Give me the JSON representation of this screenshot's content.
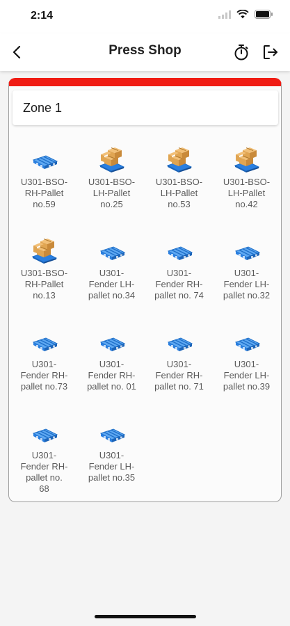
{
  "status_bar": {
    "time": "2:14"
  },
  "app_bar": {
    "title": "Press Shop"
  },
  "zone": {
    "title": "Zone 1",
    "pallets": [
      {
        "label": "U301-BSO-\nRH-Pallet\nno.59",
        "icon": "empty-pallet-icon"
      },
      {
        "label": "U301-BSO-\nLH-Pallet\nno.25",
        "icon": "loaded-pallet-icon"
      },
      {
        "label": "U301-BSO-\nLH-Pallet\nno.53",
        "icon": "loaded-pallet-icon"
      },
      {
        "label": "U301-BSO-\nLH-Pallet\nno.42",
        "icon": "loaded-pallet-icon"
      },
      {
        "label": "U301-BSO-\nRH-Pallet\nno.13",
        "icon": "loaded-pallet-icon"
      },
      {
        "label": "U301-\nFender LH-\npallet no.34",
        "icon": "empty-pallet-icon"
      },
      {
        "label": "U301-\nFender RH-\npallet no. 74",
        "icon": "empty-pallet-icon"
      },
      {
        "label": "U301-\nFender LH-\npallet no.32",
        "icon": "empty-pallet-icon"
      },
      {
        "label": "U301-\nFender RH-\npallet no.73",
        "icon": "empty-pallet-icon"
      },
      {
        "label": "U301-\nFender RH-\npallet no. 01",
        "icon": "empty-pallet-icon"
      },
      {
        "label": "U301-\nFender RH-\npallet no. 71",
        "icon": "empty-pallet-icon"
      },
      {
        "label": "U301-\nFender LH-\npallet no.39",
        "icon": "empty-pallet-icon"
      },
      {
        "label": "U301-\nFender RH-\npallet no.\n68",
        "icon": "empty-pallet-icon"
      },
      {
        "label": "U301-\nFender LH-\npallet no.35",
        "icon": "empty-pallet-icon"
      }
    ]
  },
  "colors": {
    "zone_accent": "#f01c14",
    "pallet_blue": "#2a7fe0",
    "box_tan": "#e0a552"
  }
}
